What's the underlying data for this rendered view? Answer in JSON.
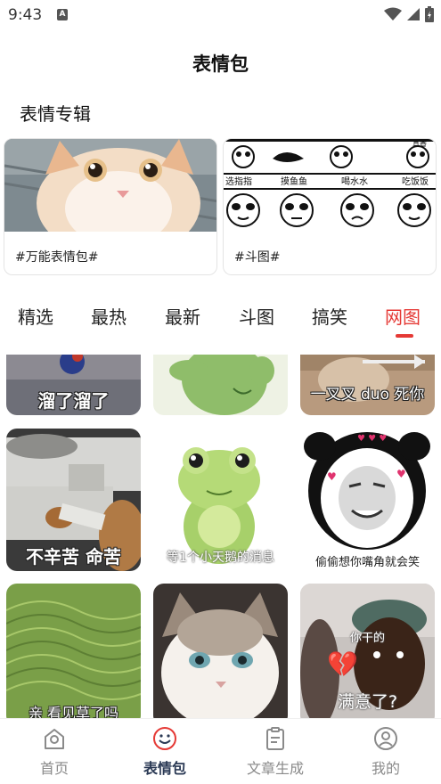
{
  "status_bar": {
    "time": "9:43",
    "notification_badge": "A"
  },
  "header": {
    "title": "表情包"
  },
  "albums": {
    "section_title": "表情专辑",
    "items": [
      {
        "label": "#万能表情包#"
      },
      {
        "label": "#斗图#",
        "strip_labels": [
          "选指指",
          "摸鱼鱼",
          "喝水水",
          "吃饭饭",
          "真香"
        ]
      }
    ]
  },
  "tabs": {
    "items": [
      "精选",
      "最热",
      "最新",
      "斗图",
      "搞笑",
      "网图"
    ],
    "active_index": 5
  },
  "grid": {
    "tiles": [
      {
        "caption": "溜了溜了"
      },
      {
        "caption": ""
      },
      {
        "caption": "一叉叉 duo 死你"
      },
      {
        "caption": "不辛苦 命苦"
      },
      {
        "caption": "等1个小天鹅的消息"
      },
      {
        "caption": "偷偷想你嘴角就会笑"
      },
      {
        "caption": "亲 看见草了吗"
      },
      {
        "caption": ""
      },
      {
        "caption": "满意了?",
        "sub_caption": "你干的"
      }
    ]
  },
  "bottom_nav": {
    "items": [
      {
        "label": "首页",
        "icon": "home-icon"
      },
      {
        "label": "表情包",
        "icon": "smile-icon"
      },
      {
        "label": "文章生成",
        "icon": "document-icon"
      },
      {
        "label": "我的",
        "icon": "user-icon"
      }
    ],
    "active_index": 1
  },
  "colors": {
    "accent": "#e53935",
    "nav_active": "#2b3a55",
    "nav_inactive": "#8a8a8a"
  }
}
